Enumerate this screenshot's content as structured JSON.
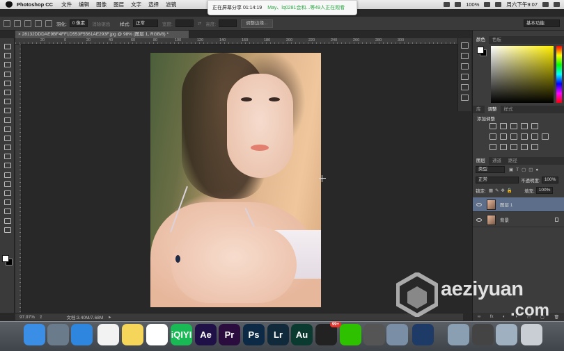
{
  "menubar": {
    "app_name": "Photoshop CC",
    "menus": [
      "文件",
      "编辑",
      "图像",
      "图层",
      "文字",
      "选择",
      "滤镜"
    ],
    "battery": "100%",
    "clock": "周六下午9:07"
  },
  "share_bar": {
    "status": "正在屏幕分享 01:14:19",
    "viewers": "May、lq0281会和...等49人正在观看"
  },
  "options_bar": {
    "feather_label": "羽化:",
    "feather_value": "0 像素",
    "antialias_label": "消除锯齿",
    "style_label": "样式:",
    "style_value": "正常",
    "width_label": "宽度:",
    "height_label": "高度:",
    "refine_edge_button": "调整边缘...",
    "workspace": "基本功能"
  },
  "document": {
    "tab_title": "28132DDDAE9BF4FF1D553F5561AE293F.jpg @ 98% (图层 1, RGB/8) *",
    "ruler_ticks": [
      "20",
      "0",
      "20",
      "40",
      "60",
      "80",
      "100",
      "120",
      "140",
      "160",
      "180",
      "200",
      "220",
      "240",
      "260",
      "280",
      "300"
    ]
  },
  "status_bar": {
    "zoom": "97.97%",
    "doc_size": "文档:3.40M/7.68M"
  },
  "panels": {
    "color_tabs": [
      "颜色",
      "色板"
    ],
    "adjust_tabs": [
      "库",
      "调整",
      "样式"
    ],
    "adjust_title": "添加调整",
    "layer_tabs": [
      "图层",
      "通道",
      "路径"
    ],
    "kind_filter": "类型",
    "blend_mode": "正常",
    "opacity_label": "不透明度:",
    "opacity_value": "100%",
    "lock_label": "锁定:",
    "fill_label": "填充:",
    "fill_value": "100%",
    "layers": [
      {
        "name": "图层 1",
        "selected": true
      },
      {
        "name": "背景",
        "selected": false
      }
    ],
    "footer_icons": [
      "link-icon",
      "fx",
      "mask-icon",
      "adjust-icon",
      "folder-icon",
      "new-layer-icon",
      "trash-icon"
    ]
  },
  "watermark": {
    "brand": "aeziyuan",
    "tld": ".com"
  },
  "dock": {
    "apps": [
      {
        "name": "Finder",
        "label": "",
        "color": "#3a8ee6"
      },
      {
        "name": "Launchpad",
        "label": "",
        "color": "#6a7b8c"
      },
      {
        "name": "Safari",
        "label": "",
        "color": "#2e86de"
      },
      {
        "name": "Reminders",
        "label": "",
        "color": "#f2f2f2"
      },
      {
        "name": "Notes",
        "label": "",
        "color": "#f5d65a"
      },
      {
        "name": "Photos",
        "label": "",
        "color": "#ffffff"
      },
      {
        "name": "iQIYI",
        "label": "iQIYI",
        "color": "#19b955"
      },
      {
        "name": "After Effects",
        "label": "Ae",
        "color": "#1f1147"
      },
      {
        "name": "Premiere",
        "label": "Pr",
        "color": "#2a0c3f"
      },
      {
        "name": "Photoshop",
        "label": "Ps",
        "color": "#0c2a45"
      },
      {
        "name": "Lightroom",
        "label": "Lr",
        "color": "#102a3b"
      },
      {
        "name": "Audition",
        "label": "Au",
        "color": "#0b3a30"
      },
      {
        "name": "QQ",
        "label": "",
        "color": "#222222",
        "badge": "99+"
      },
      {
        "name": "WeChat",
        "label": "",
        "color": "#2dc100"
      },
      {
        "name": "Camera",
        "label": "",
        "color": "#555555"
      },
      {
        "name": "Preview",
        "label": "",
        "color": "#7a8fa6"
      },
      {
        "name": "QuickTime",
        "label": "",
        "color": "#1d3b66"
      },
      {
        "name": "Photo 1",
        "label": "",
        "color": "#8aa0b2"
      },
      {
        "name": "Photo 2",
        "label": "",
        "color": "#444444"
      },
      {
        "name": "Photo 3",
        "label": "",
        "color": "#9fb0c0"
      },
      {
        "name": "Trash",
        "label": "",
        "color": "#c9ced4"
      }
    ]
  }
}
